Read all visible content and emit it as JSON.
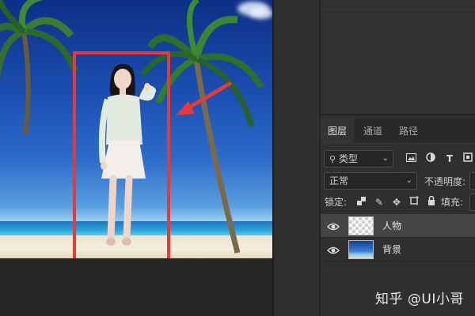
{
  "layers_panel": {
    "tabs": [
      {
        "label": "图层",
        "active": true
      },
      {
        "label": "通道",
        "active": false
      },
      {
        "label": "路径",
        "active": false
      }
    ],
    "filter": {
      "label": "类型",
      "icon": "search-icon"
    },
    "filter_icons": [
      "image-filter-icon",
      "adjustment-filter-icon",
      "type-filter-icon",
      "shape-filter-icon"
    ],
    "blend_mode": "正常",
    "opacity_label": "不透明度:",
    "lock_label": "锁定:",
    "lock_icons": [
      "lock-transparent-icon",
      "lock-paint-icon",
      "lock-move-icon",
      "lock-artboard-icon",
      "lock-all-icon"
    ],
    "fill_label": "填充:",
    "layers": [
      {
        "name": "人物",
        "visible": true,
        "selected": true,
        "thumb": "transparent"
      },
      {
        "name": "背景",
        "visible": true,
        "selected": false,
        "thumb": "beach"
      }
    ]
  },
  "annotation": {
    "color": "#e43a3a"
  },
  "watermark": "知乎 @UI小哥"
}
